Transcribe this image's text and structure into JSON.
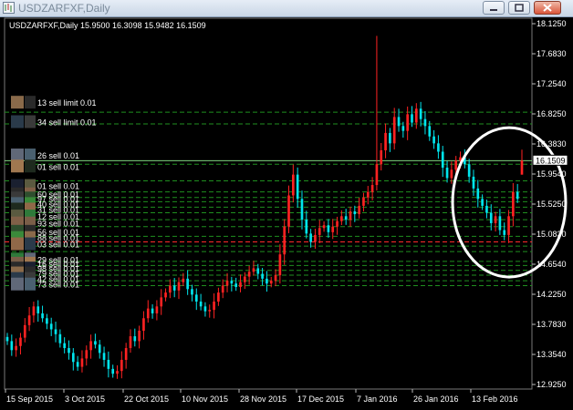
{
  "window": {
    "title": "USDZARFXF,Daily",
    "icon": "chart-window-icon",
    "buttons": [
      "minimize-icon",
      "restore-icon",
      "close-icon"
    ]
  },
  "chart_header": {
    "symbol_text": "USDZARFXF,Daily  15.9500 16.3098 15.9482 16.1509"
  },
  "chart_data": {
    "type": "candlestick",
    "symbol": "USDZARFXF",
    "timeframe": "Daily",
    "last_bar": {
      "open": 15.95,
      "high": 16.3098,
      "low": 15.9482,
      "close": 16.1509
    },
    "current_price_label": "16.1509",
    "ylim": [
      12.925,
      18.125
    ],
    "y_ticks": [
      "18.1250",
      "17.6830",
      "17.2540",
      "16.8250",
      "16.3830",
      "15.9540",
      "15.5250",
      "15.0830",
      "14.6540",
      "14.2250",
      "13.7830",
      "13.3540",
      "12.9250"
    ],
    "x_ticks": [
      "15 Sep 2015",
      "3 Oct 2015",
      "22 Oct 2015",
      "10 Nov 2015",
      "28 Nov 2015",
      "17 Dec 2015",
      "7 Jan 2016",
      "26 Jan 2016",
      "13 Feb 2016"
    ],
    "colors": {
      "bull": "#ff2222",
      "bear": "#00e5ee",
      "grid_line": "#1f8f1f",
      "highlight_line": "#7fd37f",
      "red_line": "#ff2a2a",
      "annotation_circle": "#ffffff"
    },
    "closes": [
      13.55,
      13.42,
      13.48,
      13.6,
      13.78,
      13.92,
      14.05,
      13.95,
      13.88,
      13.8,
      13.72,
      13.65,
      13.52,
      13.45,
      13.38,
      13.25,
      13.18,
      13.3,
      13.42,
      13.55,
      13.5,
      13.38,
      13.28,
      13.15,
      13.08,
      13.12,
      13.28,
      13.45,
      13.62,
      13.55,
      13.7,
      13.88,
      14.02,
      13.95,
      14.05,
      14.18,
      14.25,
      14.35,
      14.28,
      14.4,
      14.45,
      14.3,
      14.22,
      14.12,
      14.05,
      13.98,
      14.0,
      14.12,
      14.25,
      14.35,
      14.42,
      14.38,
      14.33,
      14.4,
      14.48,
      14.55,
      14.6,
      14.52,
      14.45,
      14.38,
      14.42,
      14.5,
      14.8,
      15.2,
      15.65,
      15.95,
      15.6,
      15.3,
      15.1,
      14.98,
      15.08,
      15.18,
      15.22,
      15.12,
      15.2,
      15.28,
      15.35,
      15.3,
      15.42,
      15.38,
      15.5,
      15.62,
      15.7,
      15.8,
      16.1,
      16.3,
      16.55,
      16.4,
      16.78,
      16.65,
      16.58,
      16.82,
      16.7,
      16.9,
      16.75,
      16.65,
      16.5,
      16.4,
      16.28,
      16.05,
      15.9,
      16.02,
      16.15,
      16.2,
      16.1,
      15.92,
      15.75,
      15.6,
      15.5,
      15.4,
      15.25,
      15.35,
      15.15,
      15.08,
      15.35,
      15.7,
      15.6,
      16.15
    ],
    "price_lines": [
      {
        "price": 16.85,
        "style": "dashed"
      },
      {
        "price": 16.68,
        "style": "dashed"
      },
      {
        "price": 16.1509,
        "style": "solid-light"
      },
      {
        "price": 16.1,
        "style": "dashed"
      },
      {
        "price": 15.86,
        "style": "dashed"
      },
      {
        "price": 15.7,
        "style": "dashed"
      },
      {
        "price": 15.62,
        "style": "dashed"
      },
      {
        "price": 15.56,
        "style": "dashed"
      },
      {
        "price": 15.48,
        "style": "dashed"
      },
      {
        "price": 15.4,
        "style": "dashed"
      },
      {
        "price": 15.3,
        "style": "dashed"
      },
      {
        "price": 15.2,
        "style": "dashed"
      },
      {
        "price": 15.06,
        "style": "dashed"
      },
      {
        "price": 14.98,
        "style": "red"
      },
      {
        "price": 14.92,
        "style": "dashed"
      },
      {
        "price": 14.84,
        "style": "dashed"
      },
      {
        "price": 14.7,
        "style": "dashed"
      },
      {
        "price": 14.64,
        "style": "dashed"
      },
      {
        "price": 14.57,
        "style": "dashed"
      },
      {
        "price": 14.5,
        "style": "dashed"
      },
      {
        "price": 14.42,
        "style": "dashed"
      },
      {
        "price": 14.35,
        "style": "dashed"
      }
    ],
    "order_labels": [
      {
        "text": "13 sell limit 0.01",
        "price": 16.98
      },
      {
        "text": "34 sell limit 0.01",
        "price": 16.7
      },
      {
        "text": "26 sell 0.01",
        "price": 16.22
      },
      {
        "text": "01 sell 0.01",
        "price": 16.06
      },
      {
        "text": "01 sell 0.01",
        "price": 15.78
      },
      {
        "text": "60 sell 0.01",
        "price": 15.66
      },
      {
        "text": "97 sell 0.01",
        "price": 15.6
      },
      {
        "text": "40 sell 0.01",
        "price": 15.52
      },
      {
        "text": "31 sell 0.01",
        "price": 15.44
      },
      {
        "text": "12 sell 0.01",
        "price": 15.34
      },
      {
        "text": "93 sell 0.01",
        "price": 15.24
      },
      {
        "text": "56 sell 0.01",
        "price": 15.12
      },
      {
        "text": "88 sell 0.01",
        "price": 15.03
      },
      {
        "text": "03 sell 0.01",
        "price": 14.94
      },
      {
        "text": "29 sell 0.01",
        "price": 14.72
      },
      {
        "text": "16 sell 0.01",
        "price": 14.66
      },
      {
        "text": "98 sell 0.01",
        "price": 14.59
      },
      {
        "text": "79 sell 0.01",
        "price": 14.52
      },
      {
        "text": "42 sell 0.01",
        "price": 14.44
      },
      {
        "text": "73 sell 0.01",
        "price": 14.36
      }
    ]
  }
}
